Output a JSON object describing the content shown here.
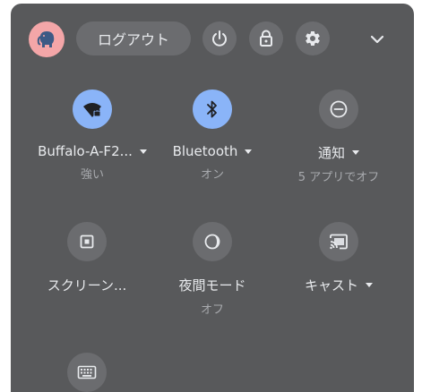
{
  "header": {
    "signout_label": "ログアウト"
  },
  "tiles": [
    {
      "label": "Buffalo-A-F2...",
      "sub": "強い",
      "icon": "wifi-lock-icon",
      "state": "on"
    },
    {
      "label": "Bluetooth",
      "sub": "オン",
      "icon": "bluetooth-icon",
      "state": "on"
    },
    {
      "label": "通知",
      "sub": "5 アプリでオフ",
      "icon": "do-not-disturb-icon",
      "state": "off"
    },
    {
      "label": "スクリーン...",
      "sub": "",
      "icon": "screen-capture-icon",
      "state": "off"
    },
    {
      "label": "夜間モード",
      "sub": "オフ",
      "icon": "night-light-icon",
      "state": "off"
    },
    {
      "label": "キャスト",
      "sub": "",
      "icon": "cast-icon",
      "state": "off"
    },
    {
      "label": "",
      "sub": "",
      "icon": "keyboard-icon",
      "state": "off"
    }
  ],
  "colors": {
    "panel": "#58595b",
    "button": "#6b6c6f",
    "accent_on": "#8ab4f8",
    "text": "#e8eaed",
    "subtext": "#a8aaae"
  }
}
